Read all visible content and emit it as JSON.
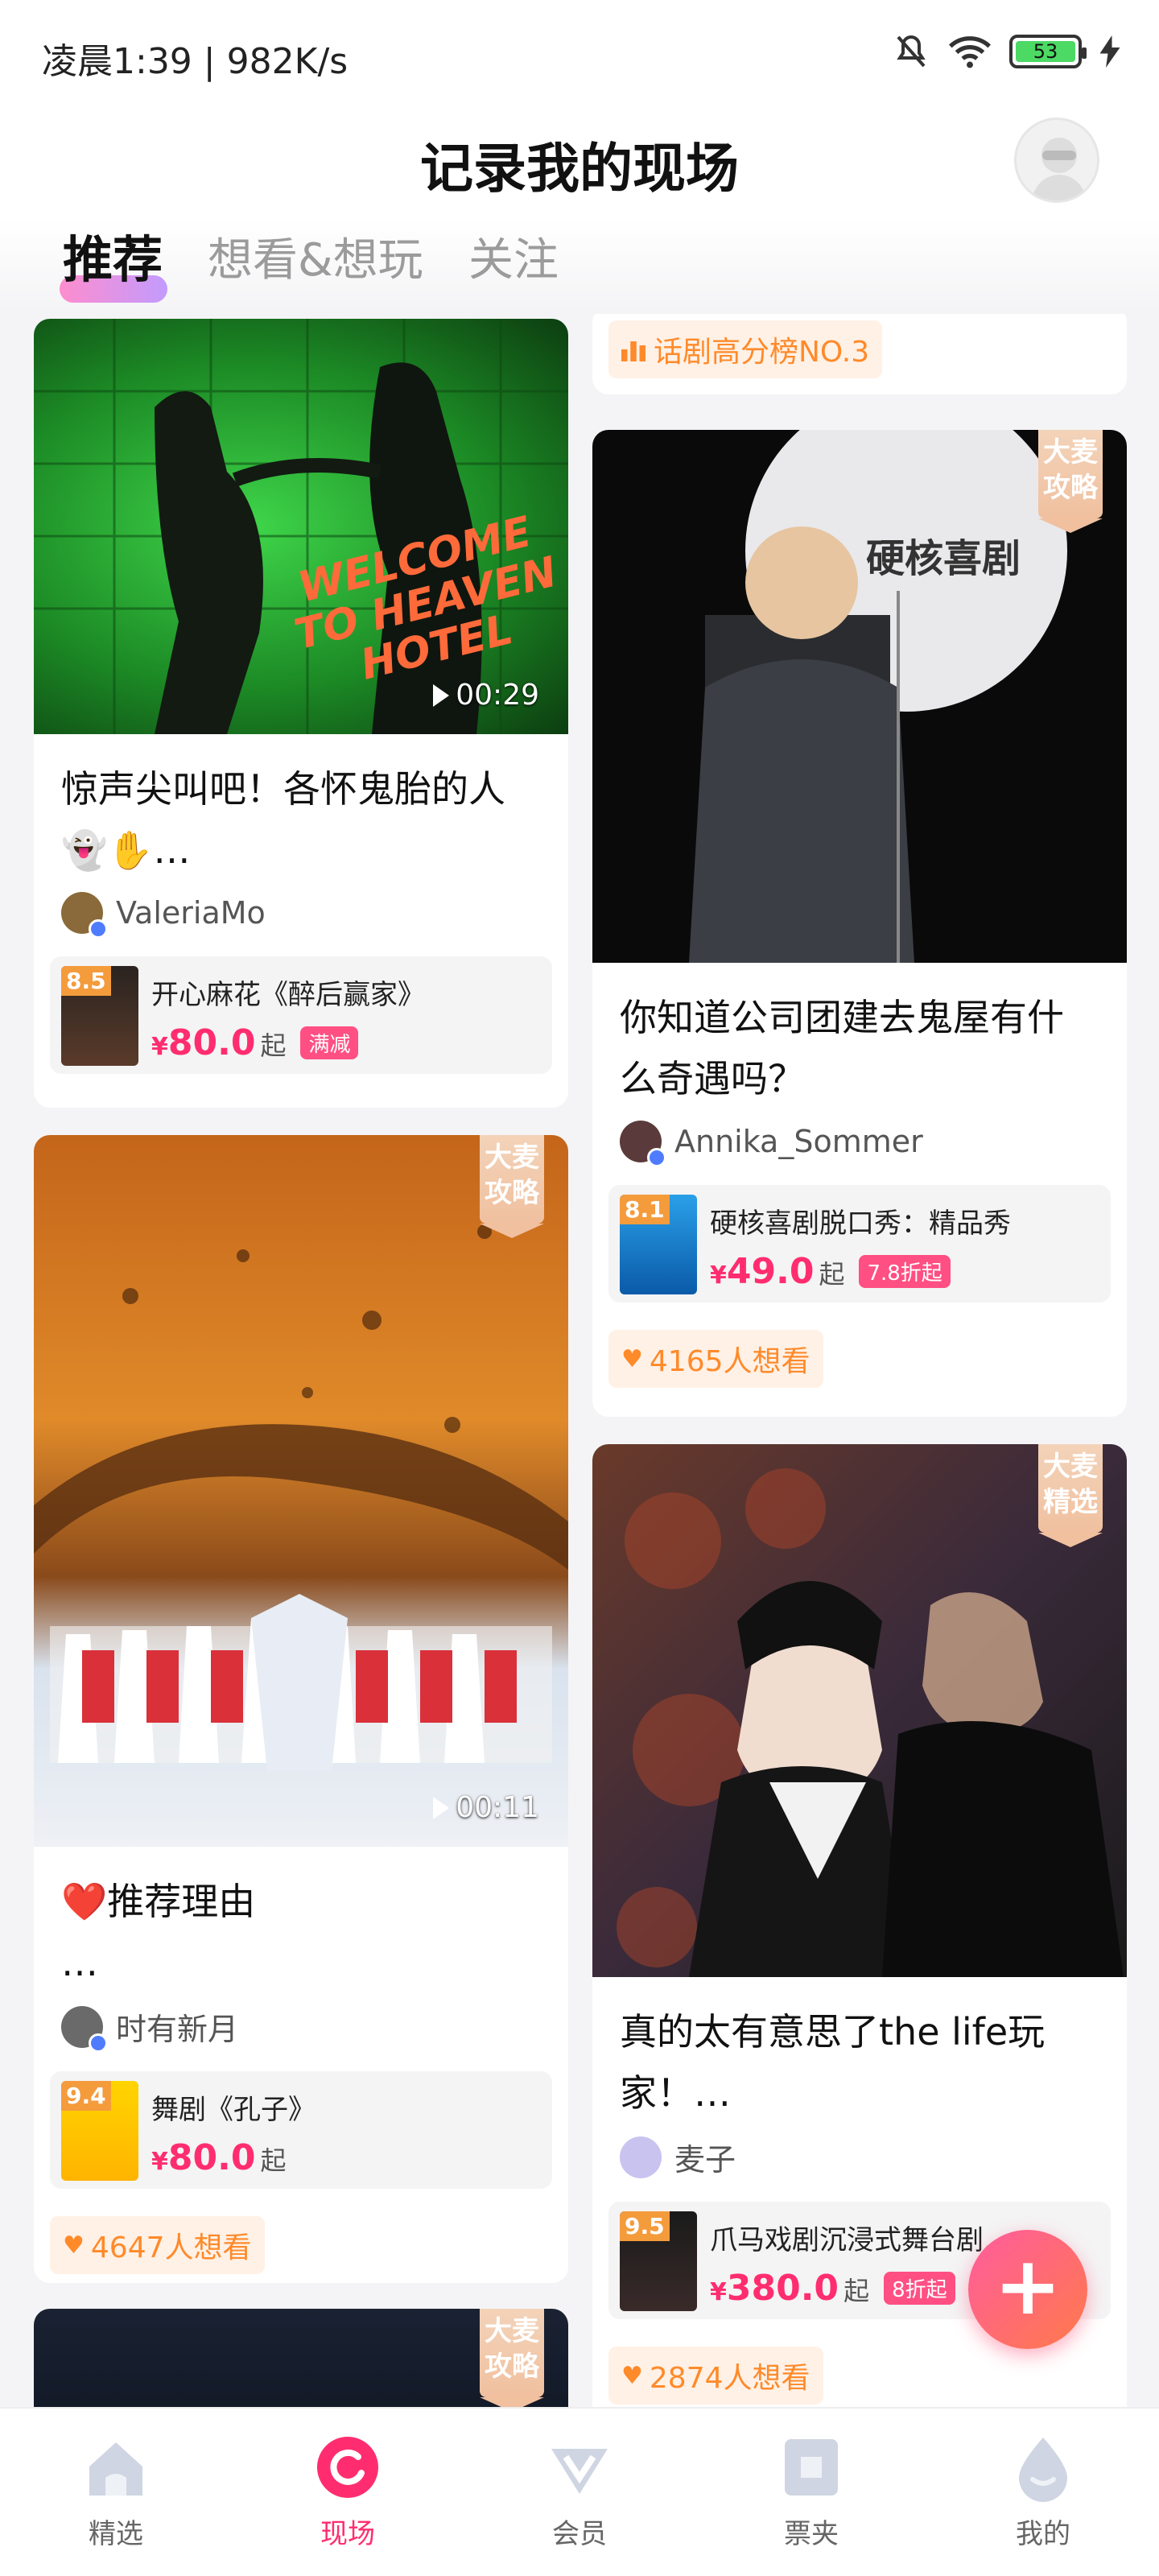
{
  "status": {
    "time": "凌晨1:39 | 982K/s",
    "battery": "53"
  },
  "header": {
    "title": "记录我的现场"
  },
  "tabs": [
    {
      "label": "推荐",
      "active": true
    },
    {
      "label": "想看&想玩",
      "active": false
    },
    {
      "label": "关注",
      "active": false
    }
  ],
  "feed": {
    "left": [
      {
        "title": "惊声尖叫吧！各怀鬼胎的人👻✋…",
        "duration": "00:29",
        "overlay_text": "WELCOME TO HEAVEN HOTEL",
        "author": "ValeriaMo",
        "product": {
          "score": "8.5",
          "name": "开心麻花《醉后赢家》",
          "price": "80.0",
          "qi": "起",
          "promo": "满减"
        }
      },
      {
        "badge": "大麦攻略",
        "title": "❤️推荐理由\n…",
        "duration": "00:11",
        "author": "时有新月",
        "product": {
          "score": "9.4",
          "name": "舞剧《孔子》",
          "price": "80.0",
          "qi": "起",
          "promo": ""
        },
        "want": "4647人想看"
      },
      {
        "badge": "大麦攻略"
      }
    ],
    "right": [
      {
        "rank": "话剧高分榜NO.3"
      },
      {
        "badge": "大麦攻略",
        "title": "你知道公司团建去鬼屋有什么奇遇吗？",
        "overlay_text": "硬核喜剧",
        "author": "Annika_Sommer",
        "product": {
          "score": "8.1",
          "name": "硬核喜剧脱口秀：精品秀",
          "price": "49.0",
          "qi": "起",
          "promo": "7.8折起"
        },
        "want": "4165人想看"
      },
      {
        "badge": "大麦精选",
        "title": "真的太有意思了the life玩家！…",
        "author": "麦子",
        "product": {
          "score": "9.5",
          "name": "爪马戏剧沉浸式舞台剧…",
          "price": "380.0",
          "qi": "起",
          "promo": "8折起"
        },
        "want": "2874人想看"
      }
    ]
  },
  "fab": {
    "label": "+"
  },
  "bottom_nav": [
    {
      "label": "精选",
      "icon": "home-icon"
    },
    {
      "label": "现场",
      "icon": "live-icon",
      "active": true
    },
    {
      "label": "会员",
      "icon": "vip-icon"
    },
    {
      "label": "票夹",
      "icon": "ticket-icon"
    },
    {
      "label": "我的",
      "icon": "profile-icon"
    }
  ],
  "colors": {
    "accent": "#ff2d6f",
    "orange": "#ff8a2a",
    "badge": "#f0c09f"
  }
}
